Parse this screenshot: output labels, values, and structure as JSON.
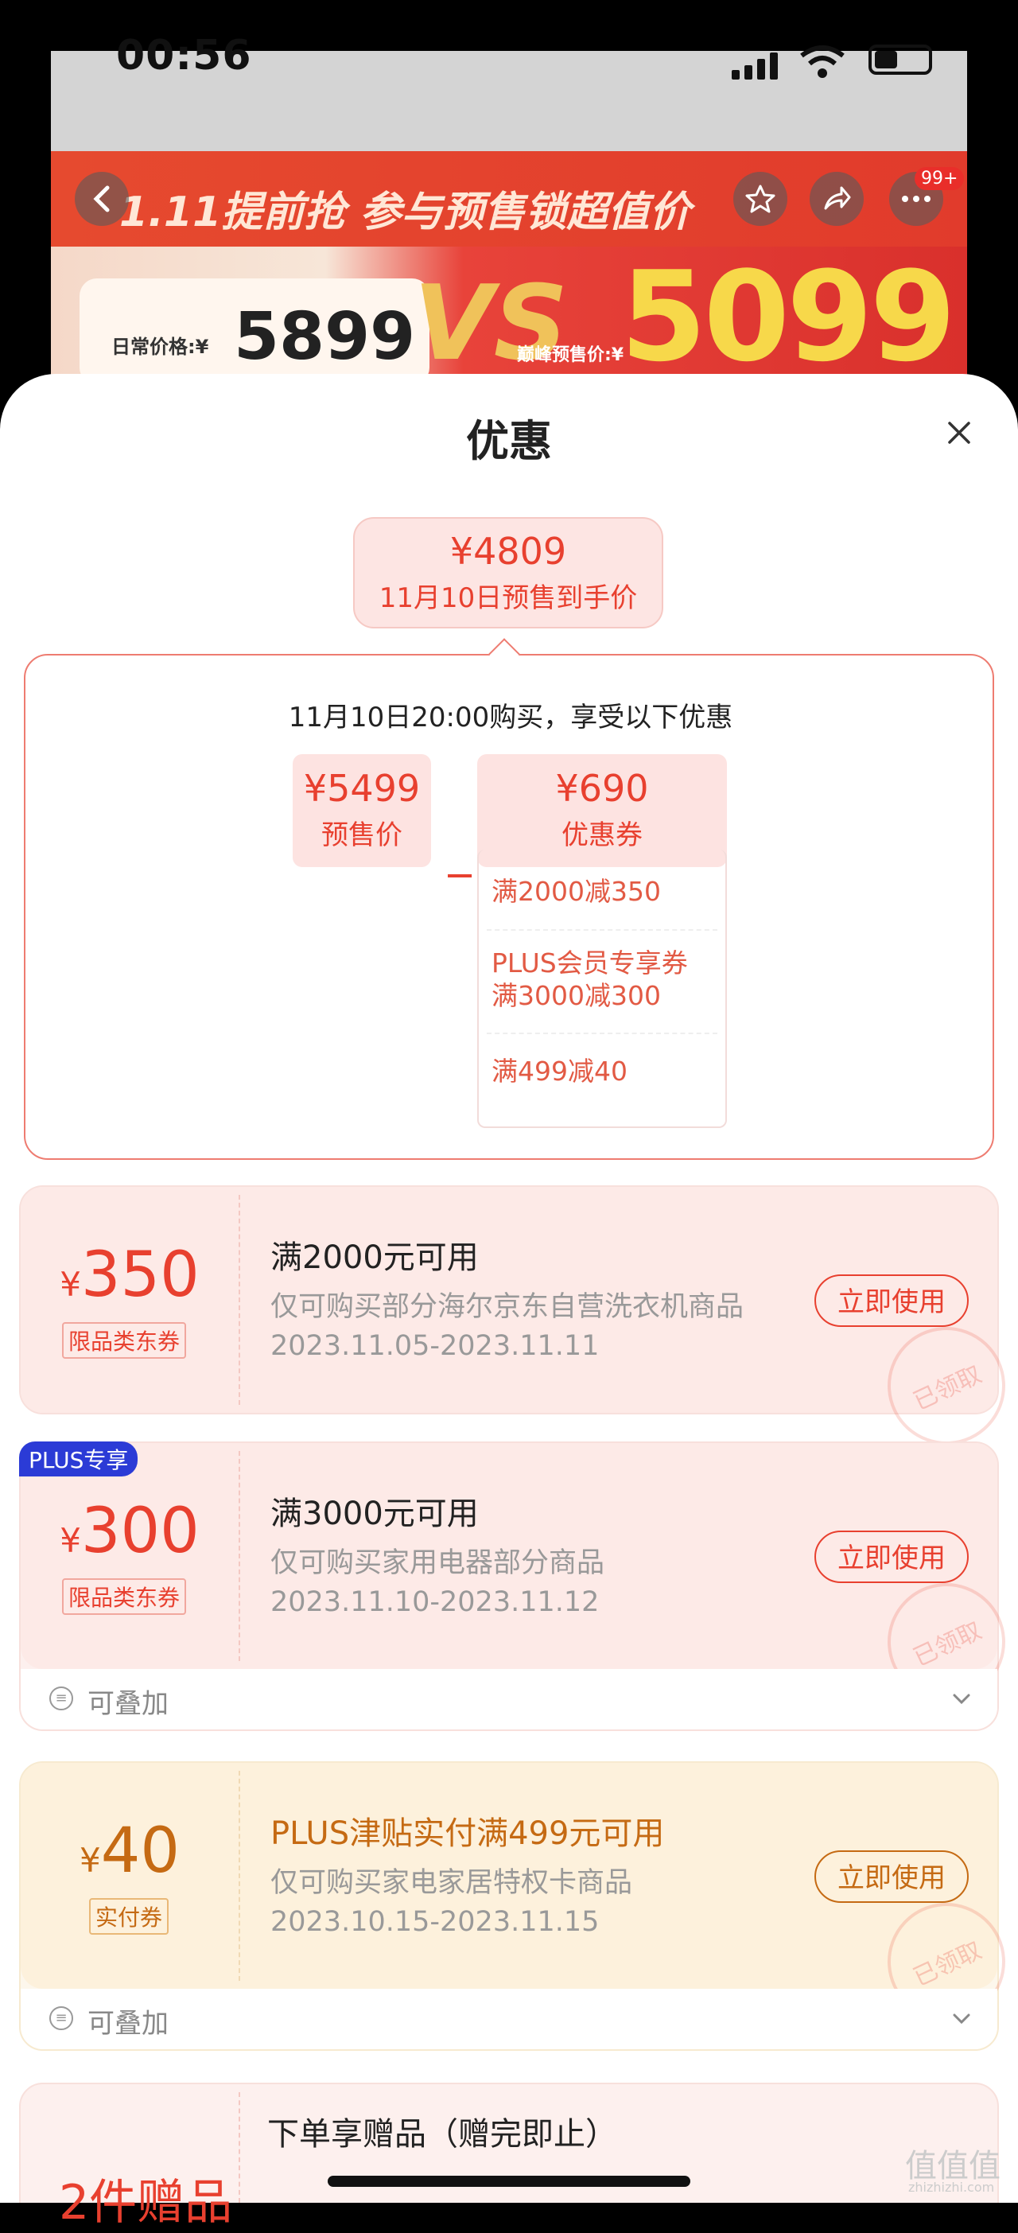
{
  "status_bar": {
    "time": "00:56"
  },
  "banner": {
    "headline": "1.11提前抢  参与预售锁超值价",
    "daily_label": "日常价格:¥",
    "daily_price": "5899",
    "vs": "VS",
    "peak_label": "巅峰预售价:¥",
    "peak_price": "5099",
    "cart_badge": "99+"
  },
  "sheet": {
    "title": "优惠",
    "summary": {
      "price": "¥4809",
      "label": "11月10日预售到手价"
    },
    "calc": {
      "heading": "11月10日20:00购买，享受以下优惠",
      "presale": {
        "value": "¥5499",
        "label": "预售价"
      },
      "operator": "−",
      "coupons": {
        "value": "¥690",
        "label": "优惠券"
      },
      "coupon_items": [
        "满2000减350",
        "PLUS会员专享券\n满3000减300",
        "满499减40"
      ]
    },
    "coupon_cards": [
      {
        "yen": "¥",
        "amount": "350",
        "tag": "限品类东券",
        "title": "满2000元可用",
        "desc": "仅可购买部分海尔京东自营洗衣机商品",
        "date": "2023.11.05-2023.11.11",
        "button": "立即使用",
        "stamp": "已领取"
      },
      {
        "badge": "PLUS专享",
        "yen": "¥",
        "amount": "300",
        "tag": "限品类东券",
        "title": "满3000元可用",
        "desc": "仅可购买家用电器部分商品",
        "date": "2023.11.10-2023.11.12",
        "button": "立即使用",
        "stamp": "已领取",
        "stack_label": "可叠加"
      },
      {
        "yen": "¥",
        "amount": "40",
        "tag": "实付券",
        "title": "PLUS津贴实付满499元可用",
        "desc": "仅可购买家电家居特权卡商品",
        "date": "2023.10.15-2023.11.15",
        "button": "立即使用",
        "stamp": "已领取",
        "stack_label": "可叠加"
      }
    ],
    "gift": {
      "title": "下单享赠品（赠完即止）",
      "amount": "2件赠品"
    }
  },
  "watermark": {
    "brand": "值值值",
    "url": "zhizhizhi.com"
  },
  "colors": {
    "accent": "#e8402f",
    "gold": "#c56a13",
    "plus_blue": "#2b3bd6"
  }
}
